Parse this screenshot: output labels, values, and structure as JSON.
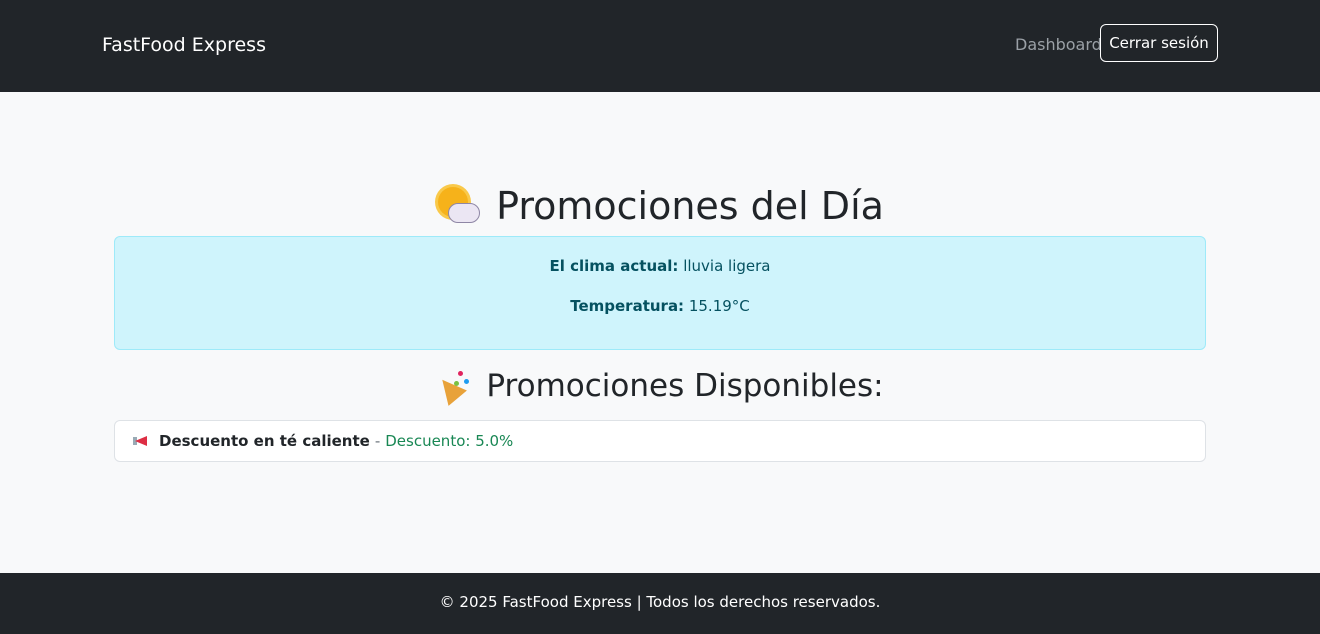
{
  "navbar": {
    "brand": "FastFood Express",
    "dashboard_link": "Dashboard",
    "logout_button": "Cerrar sesión"
  },
  "main": {
    "title": "Promociones del Día",
    "title_icon": "sun-behind-cloud-icon",
    "weather": {
      "label_clima": "El clima actual:",
      "value_clima": "lluvia ligera",
      "label_temp": "Temperatura:",
      "value_temp": "15.19°C"
    },
    "promos_title": "Promociones Disponibles:",
    "promos_icon": "party-popper-icon",
    "promotions": [
      {
        "icon": "megaphone-icon",
        "name": "Descuento en té caliente",
        "separator": "-",
        "discount": "Descuento: 5.0%"
      }
    ]
  },
  "footer": {
    "text": "© 2025 FastFood Express | Todos los derechos reservados."
  },
  "colors": {
    "navbar_bg": "#212529",
    "info_bg": "#cff4fc",
    "info_text": "#055160",
    "discount_text": "#198754"
  }
}
